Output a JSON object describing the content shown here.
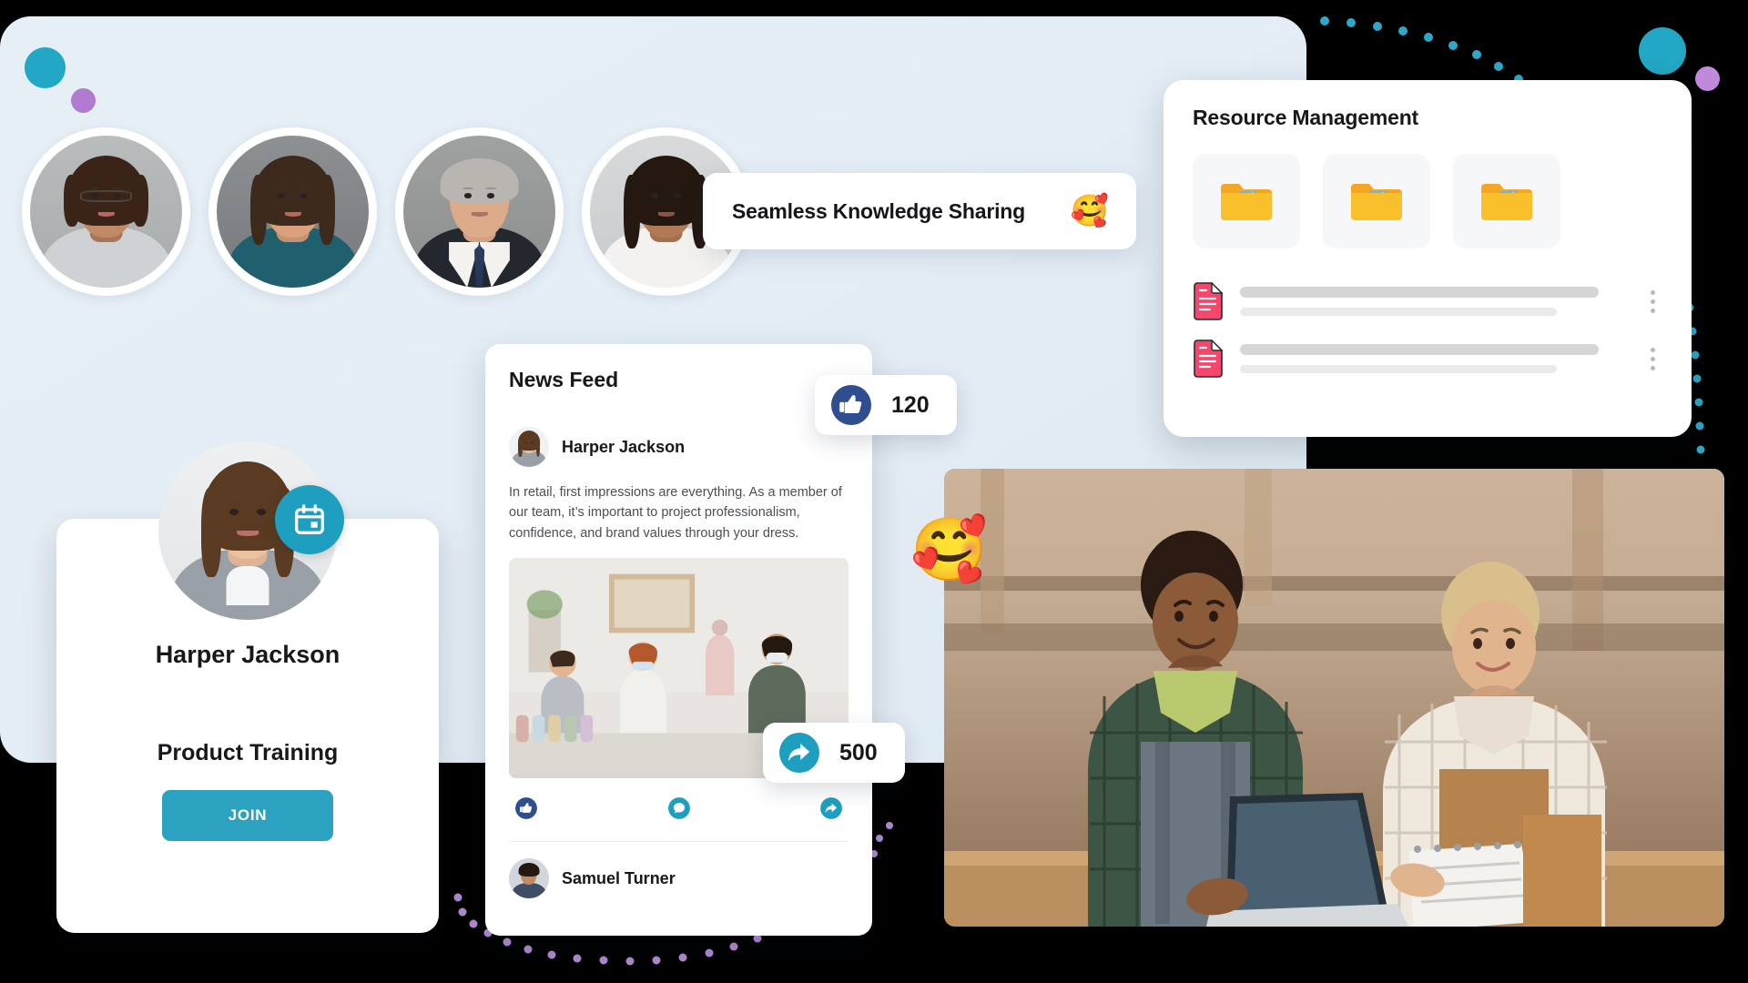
{
  "theme": {
    "background": "#000000",
    "panel_background": "#e5eef6",
    "accent_teal": "#2ba3c0",
    "accent_purple": "#b07bd0",
    "facebook_blue": "#2b4a8b",
    "folder_yellow": "#f7bb28",
    "doc_pink": "#f4476b",
    "card_white": "#ffffff"
  },
  "banner": {
    "text": "Seamless Knowledge Sharing",
    "emoji": "🥰",
    "emoji_name": "smiling-face-with-hearts"
  },
  "avatars": {
    "people": [
      {
        "name": "Avatar 1",
        "description": "woman with curly hair and glasses in grey blazer"
      },
      {
        "name": "Avatar 2",
        "description": "woman with long dark hair in teal top"
      },
      {
        "name": "Avatar 3",
        "description": "senior man with grey hair in suit and striped tie"
      },
      {
        "name": "Avatar 4",
        "description": "woman with dark hair in white top"
      }
    ]
  },
  "resource_card": {
    "title": "Resource Management",
    "folders": [
      {
        "label": "folder-1",
        "icon": "folder-document-icon"
      },
      {
        "label": "folder-2",
        "icon": "folder-document-icon"
      },
      {
        "label": "folder-3",
        "icon": "folder-document-icon"
      }
    ],
    "documents": [
      {
        "icon": "document-icon",
        "primary": "",
        "secondary": "",
        "menu": "kebab-menu-icon"
      },
      {
        "icon": "document-icon",
        "primary": "",
        "secondary": "",
        "menu": "kebab-menu-icon"
      }
    ]
  },
  "profile_card": {
    "name": "Harper Jackson",
    "course": "Product Training",
    "join_label": "JOIN",
    "badge_icon": "calendar-icon"
  },
  "feed_card": {
    "title": "News Feed",
    "post": {
      "author": "Harper Jackson",
      "body": "In retail, first impressions are everything. As a member of our team, it’s important to project professionalism, confidence, and brand values through your dress.",
      "image_alt": "retail team arranging clothing display in a store"
    },
    "actions": [
      {
        "name": "like",
        "icon": "thumbs-up-icon"
      },
      {
        "name": "comment",
        "icon": "comment-icon"
      },
      {
        "name": "share",
        "icon": "share-icon"
      }
    ],
    "commenter": "Samuel Turner"
  },
  "badges": {
    "likes": {
      "count": "120",
      "icon": "thumbs-up-icon"
    },
    "shares": {
      "count": "500",
      "icon": "share-icon"
    }
  },
  "hero_photo": {
    "alt": "two colleagues in a workshop looking at a tablet and notebook",
    "emoji": "🥰",
    "emoji_name": "smiling-face-with-hearts"
  }
}
